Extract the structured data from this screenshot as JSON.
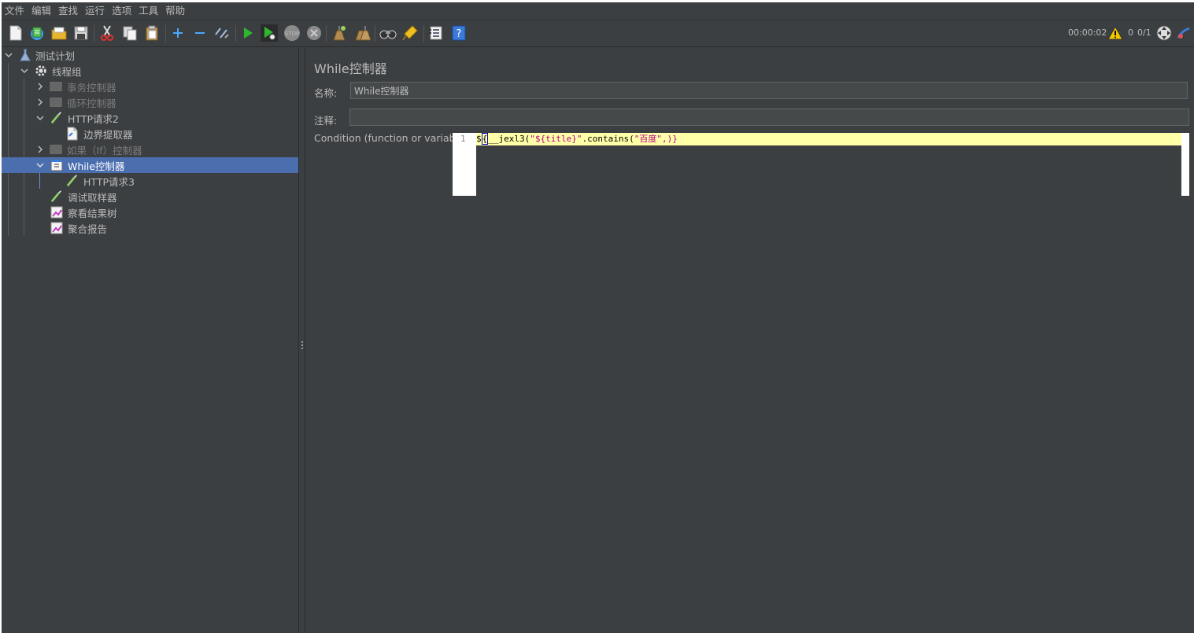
{
  "menu": [
    "文件",
    "编辑",
    "查找",
    "运行",
    "选项",
    "工具",
    "帮助"
  ],
  "toolbar": {
    "icons": [
      "new-plan-icon",
      "templates-icon",
      "open-icon",
      "save-icon",
      "cut-icon",
      "copy-icon",
      "paste-icon",
      "expand-icon",
      "collapse-icon",
      "toggle-icon",
      "start-icon",
      "start-no-pause-icon",
      "stop-icon",
      "shutdown-icon",
      "clear-icon",
      "clear-all-icon",
      "search-icon",
      "reset-search-icon",
      "function-helper-icon",
      "help-icon"
    ],
    "elapsed": "00:00:02",
    "warnings": "0",
    "threads": "0/1"
  },
  "tree": [
    {
      "label": "测试计划",
      "icon": "test-plan-icon",
      "expanded": true,
      "disabled": false
    },
    {
      "label": "线程组",
      "icon": "thread-group-gear-icon",
      "expanded": true,
      "disabled": false
    },
    {
      "label": "事务控制器",
      "icon": "transaction-controller-icon",
      "expanded": false,
      "disabled": true
    },
    {
      "label": "循环控制器",
      "icon": "loop-controller-icon",
      "expanded": false,
      "disabled": true
    },
    {
      "label": "HTTP请求2",
      "icon": "http-sampler-icon",
      "expanded": true,
      "disabled": false
    },
    {
      "label": "边界提取器",
      "icon": "extractor-icon",
      "disabled": false
    },
    {
      "label": "如果（If）控制器",
      "icon": "if-controller-icon",
      "expanded": false,
      "disabled": true
    },
    {
      "label": "While控制器",
      "icon": "while-controller-icon",
      "expanded": true,
      "disabled": false,
      "selected": true
    },
    {
      "label": "HTTP请求3",
      "icon": "http-sampler-icon",
      "disabled": false
    },
    {
      "label": "调试取样器",
      "icon": "debug-sampler-icon",
      "disabled": false
    },
    {
      "label": "察看结果树",
      "icon": "results-tree-icon",
      "disabled": false
    },
    {
      "label": "聚合报告",
      "icon": "aggregate-report-icon",
      "disabled": false
    }
  ],
  "panel": {
    "title": "While控制器",
    "name_label": "名称:",
    "name_value": "While控制器",
    "comment_label": "注释:",
    "comment_value": "",
    "condition_label": "Condition (function or variable)",
    "line_number": "1",
    "code": {
      "p1": "$",
      "p2": "{",
      "p3": "__jexl3(",
      "p4": "\"${title}\"",
      "p5": ".contains(",
      "p6": "\"百度\"",
      "p7": ",)}"
    }
  }
}
